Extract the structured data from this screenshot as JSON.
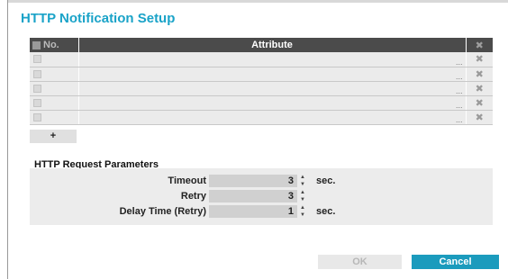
{
  "dialog": {
    "title": "HTTP Notification Setup"
  },
  "table": {
    "columns": [
      "No.",
      "Attribute"
    ],
    "delete_icon": "close-icon",
    "rows": [
      {
        "no": "",
        "attribute": "",
        "ellipsis": "..."
      },
      {
        "no": "",
        "attribute": "",
        "ellipsis": "..."
      },
      {
        "no": "",
        "attribute": "",
        "ellipsis": "..."
      },
      {
        "no": "",
        "attribute": "",
        "ellipsis": "..."
      },
      {
        "no": "",
        "attribute": "",
        "ellipsis": "..."
      }
    ],
    "add_label": "+"
  },
  "params": {
    "section_title": "HTTP Request Parameters",
    "rows": [
      {
        "label": "Timeout",
        "value": "3",
        "unit": "sec."
      },
      {
        "label": "Retry",
        "value": "3",
        "unit": ""
      },
      {
        "label": "Delay Time (Retry)",
        "value": "1",
        "unit": "sec."
      }
    ]
  },
  "buttons": {
    "ok_label": "OK",
    "cancel_label": "Cancel"
  },
  "colors": {
    "accent": "#1aa3c8",
    "header_bg": "#4b4b4b",
    "cancel_bg": "#1b9bbd"
  }
}
